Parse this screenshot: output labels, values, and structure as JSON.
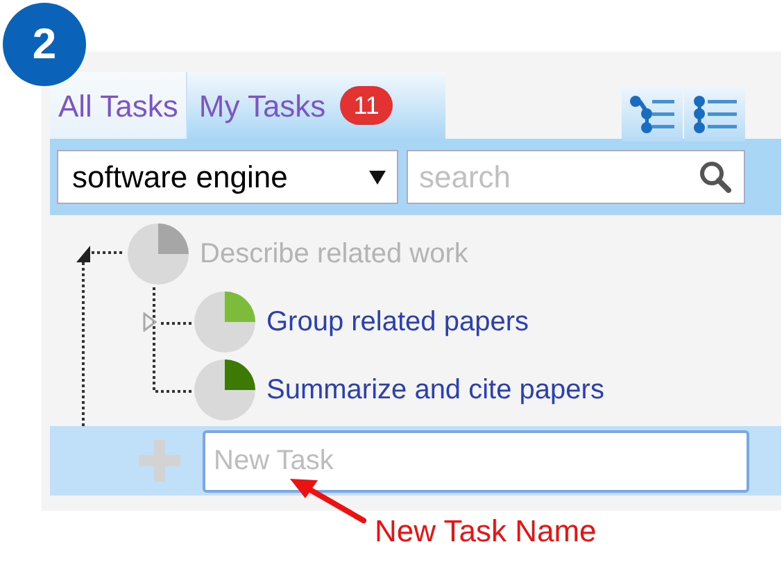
{
  "step_badge": "2",
  "tabs": [
    {
      "label": "All Tasks",
      "selected": false
    },
    {
      "label": "My Tasks",
      "selected": true,
      "count": "11"
    }
  ],
  "filter": {
    "value": "software engine"
  },
  "search": {
    "placeholder": "search"
  },
  "tasks": [
    {
      "title": "Describe related work",
      "disabled": true,
      "kind": "parent",
      "expanded": true,
      "color": "#a6a6a6",
      "children": [
        {
          "title": "Group related papers",
          "disabled": false,
          "kind": "parent",
          "expanded": false,
          "color": "#7dbb3a"
        },
        {
          "title": "Summarize and cite papers",
          "disabled": false,
          "kind": "leaf",
          "color": "#3d7a05"
        }
      ]
    }
  ],
  "new_task": {
    "placeholder": "New Task"
  },
  "annotation": "New Task Name"
}
